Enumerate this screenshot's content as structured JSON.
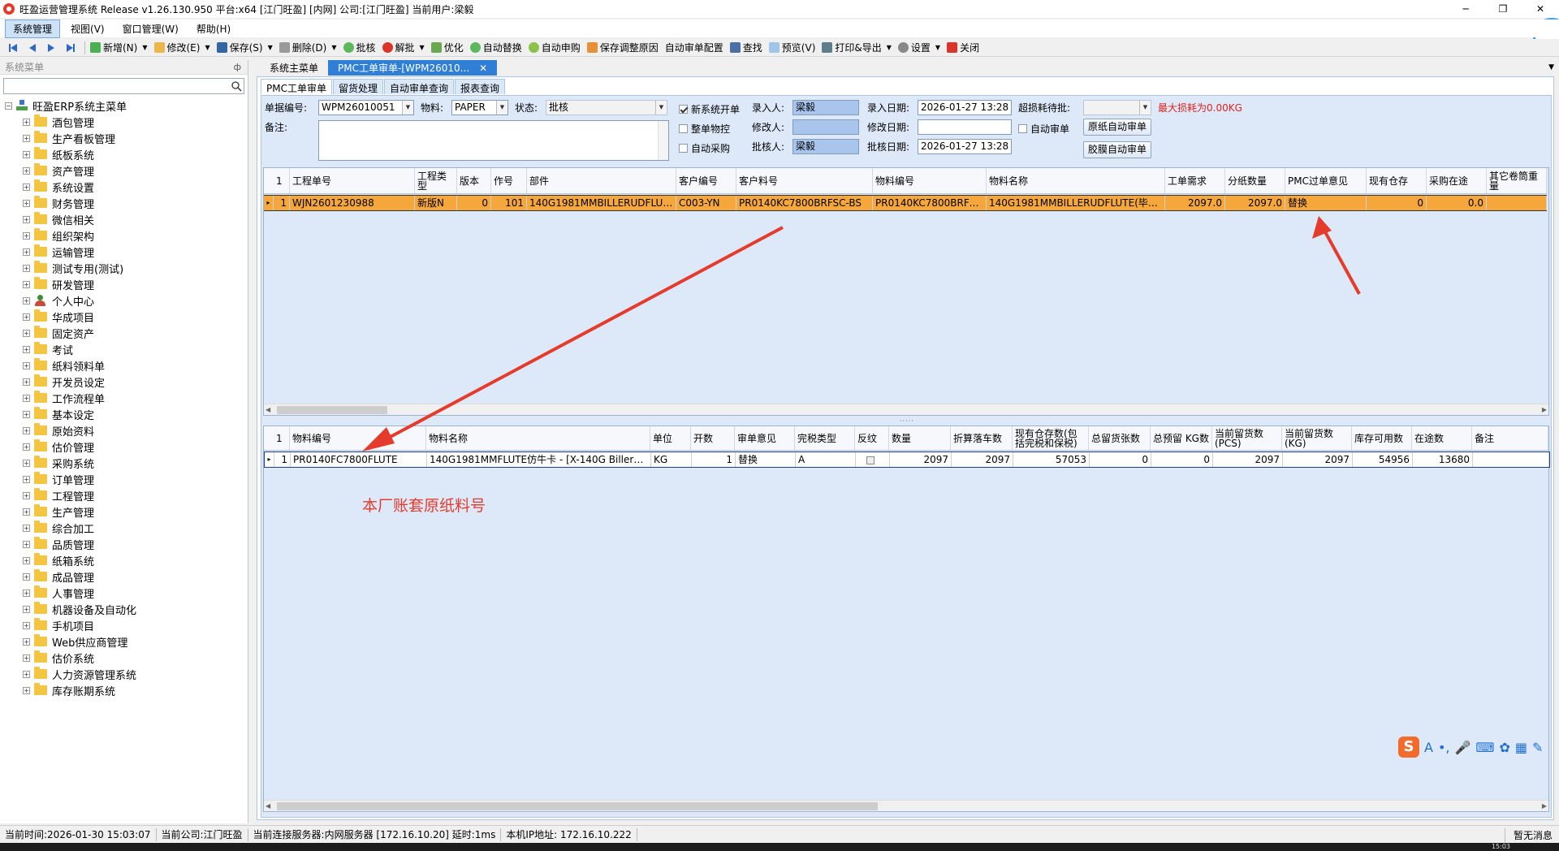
{
  "window": {
    "title": "旺盈运营管理系统 Release v1.26.130.950 平台:x64  [江门旺盈] [内网] 公司:[江门旺盈] 当前用户:梁毅",
    "controls": [
      "─",
      "❐",
      "✕"
    ]
  },
  "menu": [
    "系统管理",
    "视图(V)",
    "窗口管理(W)",
    "帮助(H)"
  ],
  "toolbar": {
    "add": "新增(N)",
    "edit": "修改(E)",
    "save": "保存(S)",
    "delete": "删除(D)",
    "approve": "批核",
    "unapprove": "解批",
    "optimize": "优化",
    "auto_replace": "自动替换",
    "auto_purchase": "自动申购",
    "save_reason": "保存调整原因",
    "auto_audit_config": "自动审单配置",
    "find": "查找",
    "preview": "预览(V)",
    "print_export": "打印&导出",
    "settings": "设置",
    "close": "关闭"
  },
  "sidebar": {
    "header": "系统菜单",
    "pin": "ф",
    "root": "旺盈ERP系统主菜单",
    "items": [
      {
        "label": "酒包管理",
        "icon": "folder"
      },
      {
        "label": "生产看板管理",
        "icon": "folder"
      },
      {
        "label": "纸板系统",
        "icon": "folder"
      },
      {
        "label": "资产管理",
        "icon": "folder"
      },
      {
        "label": "系统设置",
        "icon": "folder"
      },
      {
        "label": "财务管理",
        "icon": "folder"
      },
      {
        "label": "微信相关",
        "icon": "folder"
      },
      {
        "label": "组织架构",
        "icon": "folder"
      },
      {
        "label": "运输管理",
        "icon": "folder"
      },
      {
        "label": "测试专用(测试)",
        "icon": "folder"
      },
      {
        "label": "研发管理",
        "icon": "folder"
      },
      {
        "label": "个人中心",
        "icon": "person"
      },
      {
        "label": "华成项目",
        "icon": "folder"
      },
      {
        "label": "固定资产",
        "icon": "folder"
      },
      {
        "label": "考试",
        "icon": "folder"
      },
      {
        "label": "纸料领料单",
        "icon": "folder"
      },
      {
        "label": "开发员设定",
        "icon": "folder"
      },
      {
        "label": "工作流程单",
        "icon": "folder"
      },
      {
        "label": "基本设定",
        "icon": "folder"
      },
      {
        "label": "原始资料",
        "icon": "folder"
      },
      {
        "label": "估价管理",
        "icon": "folder"
      },
      {
        "label": "采购系统",
        "icon": "folder"
      },
      {
        "label": "订单管理",
        "icon": "folder"
      },
      {
        "label": "工程管理",
        "icon": "folder"
      },
      {
        "label": "生产管理",
        "icon": "folder"
      },
      {
        "label": "综合加工",
        "icon": "folder"
      },
      {
        "label": "品质管理",
        "icon": "folder"
      },
      {
        "label": "纸箱系统",
        "icon": "folder"
      },
      {
        "label": "成品管理",
        "icon": "folder"
      },
      {
        "label": "人事管理",
        "icon": "folder"
      },
      {
        "label": "机器设备及自动化",
        "icon": "folder"
      },
      {
        "label": "手机项目",
        "icon": "folder"
      },
      {
        "label": "Web供应商管理",
        "icon": "folder"
      },
      {
        "label": "估价系统",
        "icon": "folder"
      },
      {
        "label": "人力资源管理系统",
        "icon": "folder"
      },
      {
        "label": "库存账期系统",
        "icon": "folder"
      }
    ]
  },
  "doc_tabs": {
    "menu": "系统主菜单",
    "active": "PMC工单审单-[WPM26010...",
    "close": "✕"
  },
  "sub_tabs": [
    "PMC工单审单",
    "留货处理",
    "自动审单查询",
    "报表查询"
  ],
  "form": {
    "doc_no_label": "单据编号:",
    "doc_no": "WPM26010051",
    "material_label": "物料:",
    "material": "PAPER",
    "status_label": "状态:",
    "status": "批核",
    "new_system_label": "新系统开单",
    "whole_control_label": "整单物控",
    "auto_purchase_label": "自动采购",
    "entered_by_label": "录入人:",
    "entered_by": "梁毅",
    "modified_by_label": "修改人:",
    "modified_by": "",
    "approved_by_label": "批核人:",
    "approved_by": "梁毅",
    "entry_date_label": "录入日期:",
    "entry_date": "2026-01-27 13:28",
    "modify_date_label": "修改日期:",
    "modify_date": "",
    "approve_date_label": "批核日期:",
    "approve_date": "2026-01-27 13:28",
    "overuse_label": "超损耗待批:",
    "overuse": "",
    "max_loss": "最大损耗为0.00KG",
    "auto_audit_label": "自动审单",
    "btn_paper_audit": "原纸自动审单",
    "btn_film_audit": "胶膜自动审单",
    "remark_label": "备注:"
  },
  "upper_grid": {
    "columns": [
      "1",
      "工程单号",
      "工程类型",
      "版本",
      "作号",
      "部件",
      "客户编号",
      "客户料号",
      "物料编号",
      "物料名称",
      "工单需求",
      "分纸数量",
      "PMC过单意见",
      "现有仓存",
      "采购在途",
      "其它卷筒重量"
    ],
    "rows": [
      [
        "1",
        "WJN2601230988",
        "新版N",
        "0",
        "101",
        "140G1981MMBILLERUDFLUTE...",
        "C003-YN",
        "PR0140KC7800BRFSC-BS",
        "PR0140KC7800BRFS...",
        "140G1981MMBILLERUDFLUTE(毕瑞)...",
        "2097.0",
        "2097.0",
        "替换",
        "0",
        "0.0",
        ""
      ]
    ]
  },
  "lower_grid": {
    "columns": [
      "1",
      "物料编号",
      "物料名称",
      "单位",
      "开数",
      "审单意见",
      "完税类型",
      "反纹",
      "数量",
      "折算落车数",
      "现有仓存数(包括完税和保税)",
      "总留货张数",
      "总预留 KG数",
      "当前留货数(PCS)",
      "当前留货数(KG)",
      "库存可用数",
      "在途数",
      "备注"
    ],
    "rows": [
      [
        "1",
        "PR0140FC7800FLUTE",
        "140G1981MMFLUTE仿牛卡 - [X-140G Billerud ...",
        "KG",
        "1",
        "替换",
        "A",
        "",
        "2097",
        "2097",
        "57053",
        "0",
        "0",
        "2097",
        "2097",
        "54956",
        "13680",
        ""
      ]
    ]
  },
  "annotation": "本厂账套原纸料号",
  "status": {
    "time": "当前时间:2026-01-30 15:03:07",
    "account": "当前公司:江门旺盈",
    "server": "当前连接服务器:内网服务器   [172.16.10.20]  延时:1ms",
    "ip": "本机IP地址: 172.16.10.222",
    "message": "暂无消息"
  },
  "ime": {
    "logo": "S",
    "mode": "A"
  },
  "taskbar_clock": "15:03",
  "colors": {
    "selected_row": "#f5a73b",
    "active_tab": "#2f7fd6",
    "form_bg": "#dde9f8",
    "annotation": "#e53b2c",
    "highlight_input": "#a9c5ee"
  }
}
